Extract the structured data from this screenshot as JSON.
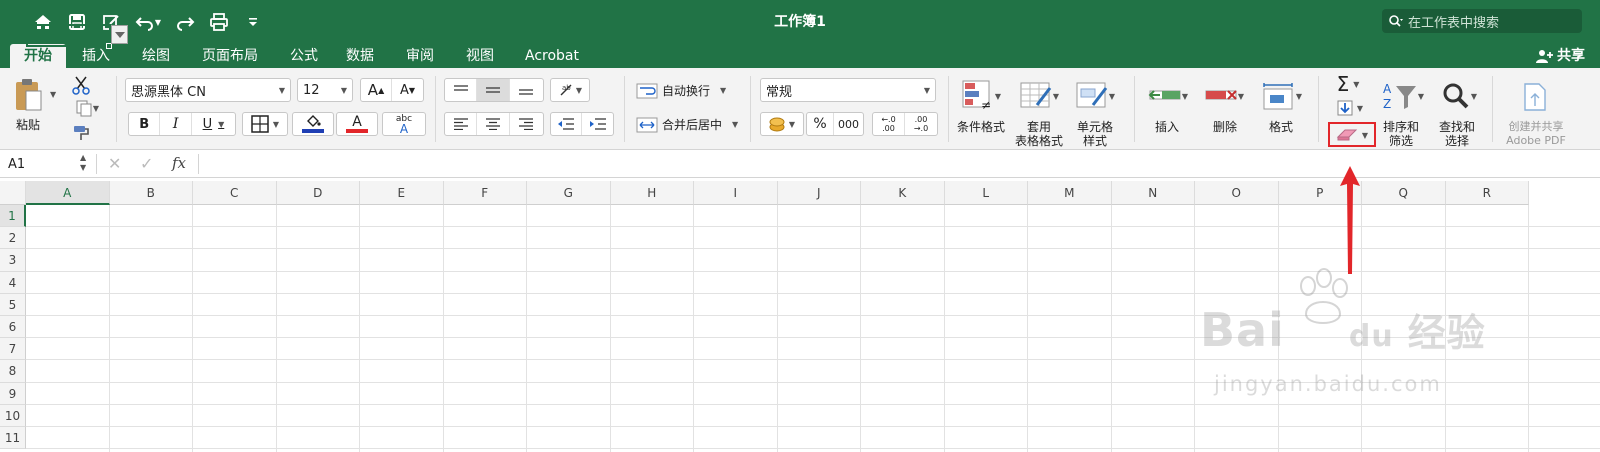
{
  "window": {
    "title": "工作簿1"
  },
  "search": {
    "placeholder": "在工作表中搜索"
  },
  "tabs": [
    {
      "label": "开始",
      "active": true
    },
    {
      "label": "插入"
    },
    {
      "label": "绘图"
    },
    {
      "label": "页面布局"
    },
    {
      "label": "公式"
    },
    {
      "label": "数据"
    },
    {
      "label": "审阅"
    },
    {
      "label": "视图"
    },
    {
      "label": "Acrobat"
    }
  ],
  "share_label": "共享",
  "ribbon": {
    "paste_label": "粘贴",
    "font_name": "思源黑体 CN",
    "font_size": "12",
    "bold": "B",
    "italic": "I",
    "underline": "U",
    "wrap_text": "自动换行",
    "merge_center": "合并后居中",
    "number_format": "常规",
    "percent": "%",
    "comma": "000",
    "conditional_format": "条件格式",
    "table_format": [
      "套用",
      "表格格式"
    ],
    "cell_style": [
      "单元格",
      "样式"
    ],
    "insert": "插入",
    "delete": "删除",
    "format": "格式",
    "sort_filter": [
      "排序和",
      "筛选"
    ],
    "find_select": [
      "查找和",
      "选择"
    ],
    "adobe": [
      "创建并共享",
      "Adobe PDF"
    ],
    "font_color": "#e2262a",
    "fill_color": "#1f3fb4",
    "accent": "#217346"
  },
  "formula_bar": {
    "cell_ref": "A1",
    "fx": "fx"
  },
  "sheet": {
    "columns": [
      "A",
      "B",
      "C",
      "D",
      "E",
      "F",
      "G",
      "H",
      "I",
      "J",
      "K",
      "L",
      "M",
      "N",
      "O",
      "P",
      "Q",
      "R"
    ],
    "rows": [
      "1",
      "2",
      "3",
      "4",
      "5",
      "6",
      "7",
      "8",
      "9",
      "10",
      "11"
    ]
  },
  "watermark": {
    "brand": "Bai",
    "brand2": "du",
    "cn": "经验",
    "url": "jingyan.baidu.com"
  }
}
